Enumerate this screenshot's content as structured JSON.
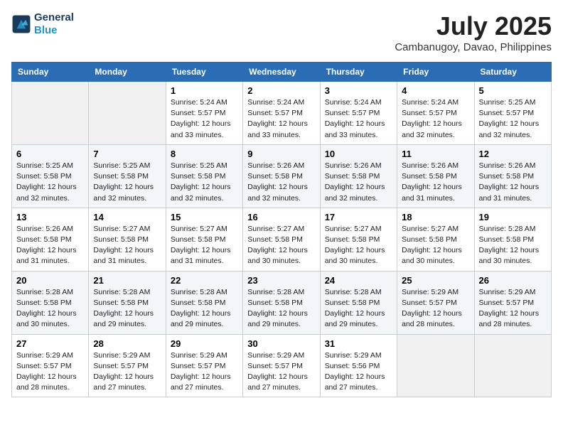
{
  "header": {
    "logo_line1": "General",
    "logo_line2": "Blue",
    "month_title": "July 2025",
    "location": "Cambanugoy, Davao, Philippines"
  },
  "weekdays": [
    "Sunday",
    "Monday",
    "Tuesday",
    "Wednesday",
    "Thursday",
    "Friday",
    "Saturday"
  ],
  "weeks": [
    [
      {
        "day": "",
        "empty": true
      },
      {
        "day": "",
        "empty": true
      },
      {
        "day": "1",
        "sunrise": "5:24 AM",
        "sunset": "5:57 PM",
        "daylight": "12 hours and 33 minutes."
      },
      {
        "day": "2",
        "sunrise": "5:24 AM",
        "sunset": "5:57 PM",
        "daylight": "12 hours and 33 minutes."
      },
      {
        "day": "3",
        "sunrise": "5:24 AM",
        "sunset": "5:57 PM",
        "daylight": "12 hours and 33 minutes."
      },
      {
        "day": "4",
        "sunrise": "5:24 AM",
        "sunset": "5:57 PM",
        "daylight": "12 hours and 32 minutes."
      },
      {
        "day": "5",
        "sunrise": "5:25 AM",
        "sunset": "5:57 PM",
        "daylight": "12 hours and 32 minutes."
      }
    ],
    [
      {
        "day": "6",
        "sunrise": "5:25 AM",
        "sunset": "5:58 PM",
        "daylight": "12 hours and 32 minutes."
      },
      {
        "day": "7",
        "sunrise": "5:25 AM",
        "sunset": "5:58 PM",
        "daylight": "12 hours and 32 minutes."
      },
      {
        "day": "8",
        "sunrise": "5:25 AM",
        "sunset": "5:58 PM",
        "daylight": "12 hours and 32 minutes."
      },
      {
        "day": "9",
        "sunrise": "5:26 AM",
        "sunset": "5:58 PM",
        "daylight": "12 hours and 32 minutes."
      },
      {
        "day": "10",
        "sunrise": "5:26 AM",
        "sunset": "5:58 PM",
        "daylight": "12 hours and 32 minutes."
      },
      {
        "day": "11",
        "sunrise": "5:26 AM",
        "sunset": "5:58 PM",
        "daylight": "12 hours and 31 minutes."
      },
      {
        "day": "12",
        "sunrise": "5:26 AM",
        "sunset": "5:58 PM",
        "daylight": "12 hours and 31 minutes."
      }
    ],
    [
      {
        "day": "13",
        "sunrise": "5:26 AM",
        "sunset": "5:58 PM",
        "daylight": "12 hours and 31 minutes."
      },
      {
        "day": "14",
        "sunrise": "5:27 AM",
        "sunset": "5:58 PM",
        "daylight": "12 hours and 31 minutes."
      },
      {
        "day": "15",
        "sunrise": "5:27 AM",
        "sunset": "5:58 PM",
        "daylight": "12 hours and 31 minutes."
      },
      {
        "day": "16",
        "sunrise": "5:27 AM",
        "sunset": "5:58 PM",
        "daylight": "12 hours and 30 minutes."
      },
      {
        "day": "17",
        "sunrise": "5:27 AM",
        "sunset": "5:58 PM",
        "daylight": "12 hours and 30 minutes."
      },
      {
        "day": "18",
        "sunrise": "5:27 AM",
        "sunset": "5:58 PM",
        "daylight": "12 hours and 30 minutes."
      },
      {
        "day": "19",
        "sunrise": "5:28 AM",
        "sunset": "5:58 PM",
        "daylight": "12 hours and 30 minutes."
      }
    ],
    [
      {
        "day": "20",
        "sunrise": "5:28 AM",
        "sunset": "5:58 PM",
        "daylight": "12 hours and 30 minutes."
      },
      {
        "day": "21",
        "sunrise": "5:28 AM",
        "sunset": "5:58 PM",
        "daylight": "12 hours and 29 minutes."
      },
      {
        "day": "22",
        "sunrise": "5:28 AM",
        "sunset": "5:58 PM",
        "daylight": "12 hours and 29 minutes."
      },
      {
        "day": "23",
        "sunrise": "5:28 AM",
        "sunset": "5:58 PM",
        "daylight": "12 hours and 29 minutes."
      },
      {
        "day": "24",
        "sunrise": "5:28 AM",
        "sunset": "5:58 PM",
        "daylight": "12 hours and 29 minutes."
      },
      {
        "day": "25",
        "sunrise": "5:29 AM",
        "sunset": "5:57 PM",
        "daylight": "12 hours and 28 minutes."
      },
      {
        "day": "26",
        "sunrise": "5:29 AM",
        "sunset": "5:57 PM",
        "daylight": "12 hours and 28 minutes."
      }
    ],
    [
      {
        "day": "27",
        "sunrise": "5:29 AM",
        "sunset": "5:57 PM",
        "daylight": "12 hours and 28 minutes."
      },
      {
        "day": "28",
        "sunrise": "5:29 AM",
        "sunset": "5:57 PM",
        "daylight": "12 hours and 27 minutes."
      },
      {
        "day": "29",
        "sunrise": "5:29 AM",
        "sunset": "5:57 PM",
        "daylight": "12 hours and 27 minutes."
      },
      {
        "day": "30",
        "sunrise": "5:29 AM",
        "sunset": "5:57 PM",
        "daylight": "12 hours and 27 minutes."
      },
      {
        "day": "31",
        "sunrise": "5:29 AM",
        "sunset": "5:56 PM",
        "daylight": "12 hours and 27 minutes."
      },
      {
        "day": "",
        "empty": true
      },
      {
        "day": "",
        "empty": true
      }
    ]
  ]
}
